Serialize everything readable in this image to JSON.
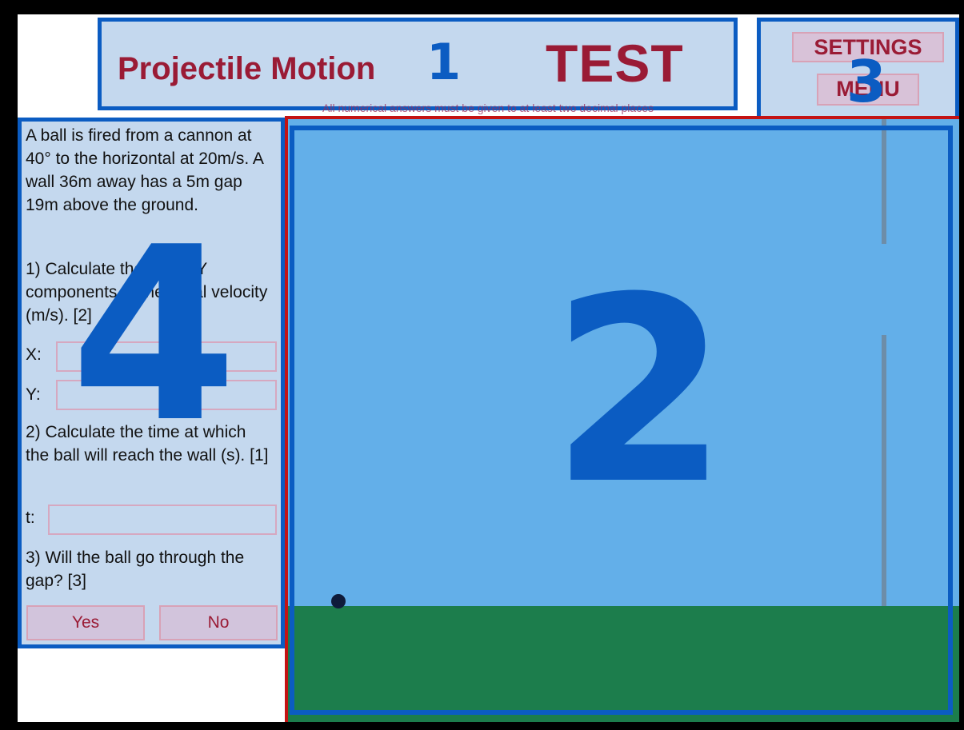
{
  "header": {
    "title": "Projectile Motion",
    "mode": "TEST",
    "note": "All numerical answers must be given to at least two decimal places"
  },
  "menu": {
    "settings_label": "SETTINGS",
    "menu_label": "MENU"
  },
  "question": {
    "intro": "A ball is fired from a cannon at 40° to the horizontal at 20m/s. A wall 36m away has a 5m gap 19m above the ground.",
    "q1": "1) Calculate the X and Y components of the initial velocity (m/s). [2]",
    "x_label": "X:",
    "y_label": "Y:",
    "q2": "2) Calculate the time at which the ball will reach the wall (s). [1]",
    "t_label": "t:",
    "q3": "3) Will the ball go through the gap? [3]",
    "yes_label": "Yes",
    "no_label": "No"
  },
  "overlays": [
    "1",
    "2",
    "3",
    "4"
  ]
}
